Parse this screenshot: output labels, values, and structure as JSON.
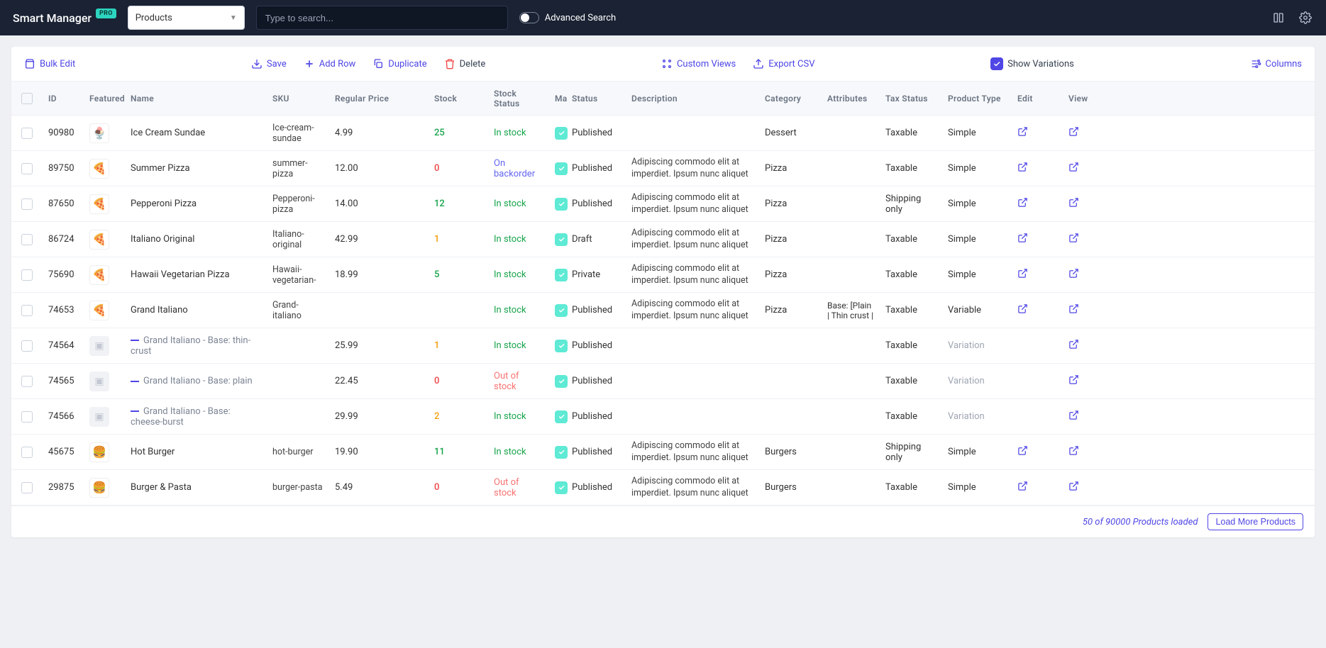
{
  "header": {
    "app_title": "Smart Manager",
    "pro_badge": "PRO",
    "selected_entity": "Products",
    "search_placeholder": "Type to search...",
    "advanced_search_label": "Advanced Search"
  },
  "toolbar": {
    "bulk_edit": "Bulk Edit",
    "save": "Save",
    "add_row": "Add Row",
    "duplicate": "Duplicate",
    "delete": "Delete",
    "custom_views": "Custom Views",
    "export_csv": "Export CSV",
    "show_variations": "Show Variations",
    "columns": "Columns"
  },
  "columns": {
    "id": "ID",
    "featured": "Featured",
    "name": "Name",
    "sku": "SKU",
    "regular_price": "Regular Price",
    "stock": "Stock",
    "stock_status": "Stock Status",
    "ma": "Ma",
    "status": "Status",
    "description": "Description",
    "category": "Category",
    "attributes": "Attributes",
    "tax_status": "Tax Status",
    "product_type": "Product Type",
    "edit": "Edit",
    "view": "View"
  },
  "rows": [
    {
      "id": "90980",
      "thumb": "🍨",
      "name": "Ice Cream Sundae",
      "sku": "Ice-cream-sundae",
      "price": "4.99",
      "stock": "25",
      "stock_color": "green",
      "stock_status": "In stock",
      "stk": "instock",
      "status": "Published",
      "desc": "",
      "category": "Dessert",
      "attributes": "",
      "tax": "Taxable",
      "ptype": "Simple",
      "variation": false,
      "edit": true,
      "view": true
    },
    {
      "id": "89750",
      "thumb": "🍕",
      "name": "Summer Pizza",
      "sku": "summer-pizza",
      "price": "12.00",
      "stock": "0",
      "stock_color": "red",
      "stock_status": "On backorder",
      "stk": "backorder",
      "status": "Published",
      "desc": "Adipiscing commodo elit at imperdiet. Ipsum nunc aliquet",
      "category": "Pizza",
      "attributes": "",
      "tax": "Taxable",
      "ptype": "Simple",
      "variation": false,
      "edit": true,
      "view": true
    },
    {
      "id": "87650",
      "thumb": "🍕",
      "name": "Pepperoni Pizza",
      "sku": "Pepperoni-pizza",
      "price": "14.00",
      "stock": "12",
      "stock_color": "green",
      "stock_status": "In stock",
      "stk": "instock",
      "status": "Published",
      "desc": "Adipiscing commodo elit at imperdiet. Ipsum nunc aliquet",
      "category": "Pizza",
      "attributes": "",
      "tax": "Shipping only",
      "ptype": "Simple",
      "variation": false,
      "edit": true,
      "view": true
    },
    {
      "id": "86724",
      "thumb": "🍕",
      "name": "Italiano Original",
      "sku": "Italiano-original",
      "price": "42.99",
      "stock": "1",
      "stock_color": "orange",
      "stock_status": "In stock",
      "stk": "instock",
      "status": "Draft",
      "desc": "Adipiscing commodo elit at imperdiet. Ipsum nunc aliquet",
      "category": "Pizza",
      "attributes": "",
      "tax": "Taxable",
      "ptype": "Simple",
      "variation": false,
      "edit": true,
      "view": true
    },
    {
      "id": "75690",
      "thumb": "🍕",
      "name": "Hawaii Vegetarian Pizza",
      "sku": "Hawaii-vegetarian-",
      "price": "18.99",
      "stock": "5",
      "stock_color": "green",
      "stock_status": "In stock",
      "stk": "instock",
      "status": "Private",
      "desc": "Adipiscing commodo elit at imperdiet. Ipsum nunc aliquet",
      "category": "Pizza",
      "attributes": "",
      "tax": "Taxable",
      "ptype": "Simple",
      "variation": false,
      "edit": true,
      "view": true
    },
    {
      "id": "74653",
      "thumb": "🍕",
      "name": "Grand Italiano",
      "sku": "Grand-italiano",
      "price": "",
      "stock": "",
      "stock_color": "",
      "stock_status": "In stock",
      "stk": "instock",
      "status": "Published",
      "desc": "Adipiscing commodo elit at imperdiet. Ipsum nunc aliquet",
      "category": "Pizza",
      "attributes": "Base: [Plain | Thin crust |",
      "tax": "Taxable",
      "ptype": "Variable",
      "variation": false,
      "edit": true,
      "view": true
    },
    {
      "id": "74564",
      "thumb": "",
      "name": "Grand Italiano - Base: thin-crust",
      "sku": "",
      "price": "25.99",
      "stock": "1",
      "stock_color": "orange",
      "stock_status": "In stock",
      "stk": "instock",
      "status": "Published",
      "desc": "",
      "category": "",
      "attributes": "",
      "tax": "Taxable",
      "ptype": "Variation",
      "variation": true,
      "edit": false,
      "view": true
    },
    {
      "id": "74565",
      "thumb": "",
      "name": "Grand Italiano - Base: plain",
      "sku": "",
      "price": "22.45",
      "stock": "0",
      "stock_color": "red",
      "stock_status": "Out of stock",
      "stk": "out",
      "status": "Published",
      "desc": "",
      "category": "",
      "attributes": "",
      "tax": "Taxable",
      "ptype": "Variation",
      "variation": true,
      "edit": false,
      "view": true
    },
    {
      "id": "74566",
      "thumb": "",
      "name": "Grand Italiano - Base: cheese-burst",
      "sku": "",
      "price": "29.99",
      "stock": "2",
      "stock_color": "orange",
      "stock_status": "In stock",
      "stk": "instock",
      "status": "Published",
      "desc": "",
      "category": "",
      "attributes": "",
      "tax": "Taxable",
      "ptype": "Variation",
      "variation": true,
      "edit": false,
      "view": true
    },
    {
      "id": "45675",
      "thumb": "🍔",
      "name": "Hot Burger",
      "sku": "hot-burger",
      "price": "19.90",
      "stock": "11",
      "stock_color": "green",
      "stock_status": "In stock",
      "stk": "instock",
      "status": "Published",
      "desc": "Adipiscing commodo elit at imperdiet. Ipsum nunc aliquet",
      "category": "Burgers",
      "attributes": "",
      "tax": "Shipping only",
      "ptype": "Simple",
      "variation": false,
      "edit": true,
      "view": true
    },
    {
      "id": "29875",
      "thumb": "🍔",
      "name": "Burger & Pasta",
      "sku": "burger-pasta",
      "price": "5.49",
      "stock": "0",
      "stock_color": "red",
      "stock_status": "Out of stock",
      "stk": "out",
      "status": "Published",
      "desc": "Adipiscing commodo elit at imperdiet. Ipsum nunc aliquet",
      "category": "Burgers",
      "attributes": "",
      "tax": "Taxable",
      "ptype": "Simple",
      "variation": false,
      "edit": true,
      "view": true
    }
  ],
  "footer": {
    "status": "50 of 90000 Products loaded",
    "load_more": "Load More Products"
  }
}
